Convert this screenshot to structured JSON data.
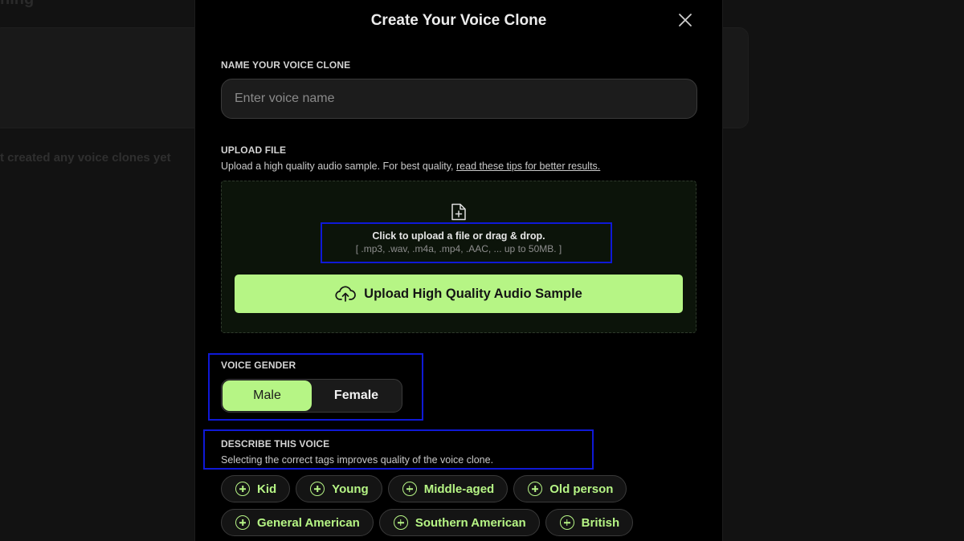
{
  "background": {
    "heading": "ning",
    "empty_message": "t created any voice clones yet"
  },
  "modal": {
    "title": "Create Your Voice Clone",
    "name_section": {
      "label": "NAME YOUR VOICE CLONE",
      "placeholder": "Enter voice name",
      "value": ""
    },
    "upload_section": {
      "label": "UPLOAD FILE",
      "description": "Upload a high quality audio sample. For best quality,",
      "tips_link": "read these tips for better results.",
      "drop_main": "Click to upload a file or drag & drop.",
      "drop_formats": "[ .mp3, .wav, .m4a, .mp4, .AAC, ... up to 50MB. ]",
      "button_label": "Upload High Quality Audio Sample"
    },
    "gender_section": {
      "label": "VOICE GENDER",
      "options": [
        "Male",
        "Female"
      ],
      "selected": "Male"
    },
    "describe_section": {
      "label": "DESCRIBE THIS VOICE",
      "description": "Selecting the correct tags improves quality of the voice clone.",
      "tags_row1": [
        "Kid",
        "Young",
        "Middle-aged",
        "Old person"
      ],
      "tags_row2": [
        "General American",
        "Southern American",
        "British"
      ]
    }
  },
  "colors": {
    "accent": "#b6f585",
    "modal_bg": "#000000",
    "highlight_box": "#0f19d6"
  },
  "icons": [
    "close-icon",
    "file-plus-icon",
    "cloud-upload-icon",
    "plus-circle-icon"
  ]
}
